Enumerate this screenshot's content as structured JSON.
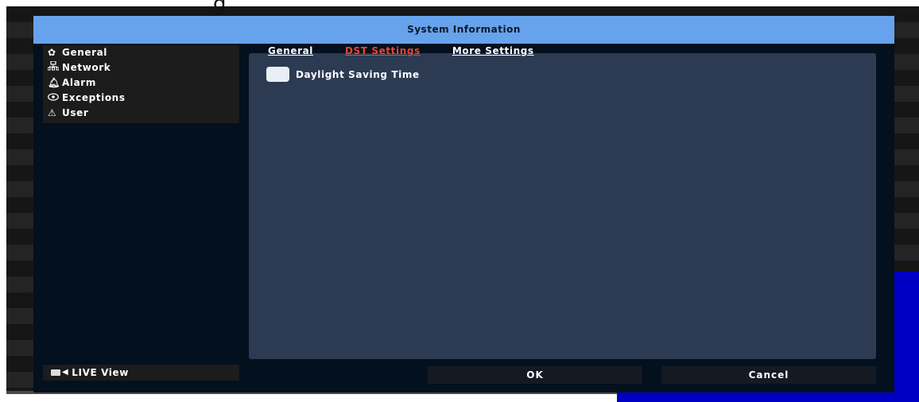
{
  "window": {
    "title": "System Information"
  },
  "top_fragment": "g",
  "sidebar": {
    "items": [
      {
        "label": "General",
        "icon": "gear-icon"
      },
      {
        "label": "Network",
        "icon": "network-icon"
      },
      {
        "label": "Alarm",
        "icon": "bell-icon"
      },
      {
        "label": "Exceptions",
        "icon": "eye-icon"
      },
      {
        "label": "User",
        "icon": "warning-icon"
      }
    ],
    "live_view": {
      "label": "LIVE View",
      "icon": "camera-icon"
    }
  },
  "tabs": [
    {
      "label": "General",
      "active": false
    },
    {
      "label": "DST Settings",
      "active": true
    },
    {
      "label": "More Settings",
      "active": false
    }
  ],
  "dst": {
    "label": "Daylight Saving Time",
    "checked": false
  },
  "buttons": {
    "ok": "OK",
    "cancel": "Cancel"
  },
  "colors": {
    "titlebar": "#66a3ec",
    "active_tab": "#e04a34",
    "panel": "#2c3b52",
    "dialog_bg": "#03101e",
    "blue_region": "#0000c4"
  }
}
